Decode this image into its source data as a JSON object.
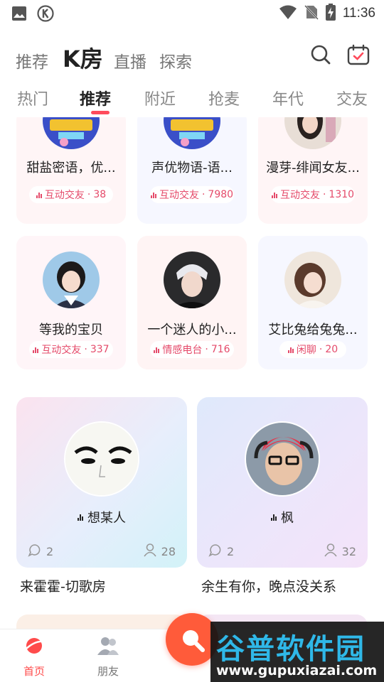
{
  "status_bar": {
    "time": "11:36",
    "left_icons": [
      "image-icon",
      "k-app-icon"
    ],
    "right_icons": [
      "wifi-icon",
      "no-sim-icon",
      "battery-charging-icon"
    ]
  },
  "top_nav": {
    "tabs": [
      {
        "label": "推荐",
        "active": false
      },
      {
        "label": "K房",
        "active": true
      },
      {
        "label": "直播",
        "active": false
      },
      {
        "label": "探索",
        "active": false
      }
    ],
    "icons": [
      "search-icon",
      "calendar-check-icon"
    ]
  },
  "sub_tabs": {
    "items": [
      "热门",
      "推荐",
      "附近",
      "抢麦",
      "年代",
      "交友"
    ],
    "active_index": 1
  },
  "small_rooms": [
    {
      "title": "甜盐密语，优...",
      "tag": "互动交友",
      "count": "38"
    },
    {
      "title": "声优物语-语...",
      "tag": "互动交友",
      "count": "7980"
    },
    {
      "title": "漫芽-绯闻女友...",
      "tag": "互动交友",
      "count": "1310"
    },
    {
      "title": "等我的宝贝",
      "tag": "互动交友",
      "count": "337"
    },
    {
      "title": "一个迷人的小...",
      "tag": "情感电台",
      "count": "716"
    },
    {
      "title": "艾比兔给兔兔...",
      "tag": "闲聊",
      "count": "20"
    }
  ],
  "big_rooms": [
    {
      "host": "想某人",
      "comments": "2",
      "listeners": "28",
      "caption": "来霍霍-切歌房"
    },
    {
      "host": "枫",
      "comments": "2",
      "listeners": "32",
      "caption": "余生有你，晚点没关系"
    }
  ],
  "bottom_nav": {
    "items": [
      {
        "label": "首页",
        "active": true
      },
      {
        "label": "朋友",
        "active": false
      }
    ]
  },
  "watermark": {
    "title": "谷普软件园",
    "url": "www.gupuxiazai.com"
  },
  "colors": {
    "accent": "#ff4b5c",
    "tag_text": "#e54a6a",
    "fab": "#ff5b3a",
    "watermark_blue": "#2fb8e8"
  }
}
